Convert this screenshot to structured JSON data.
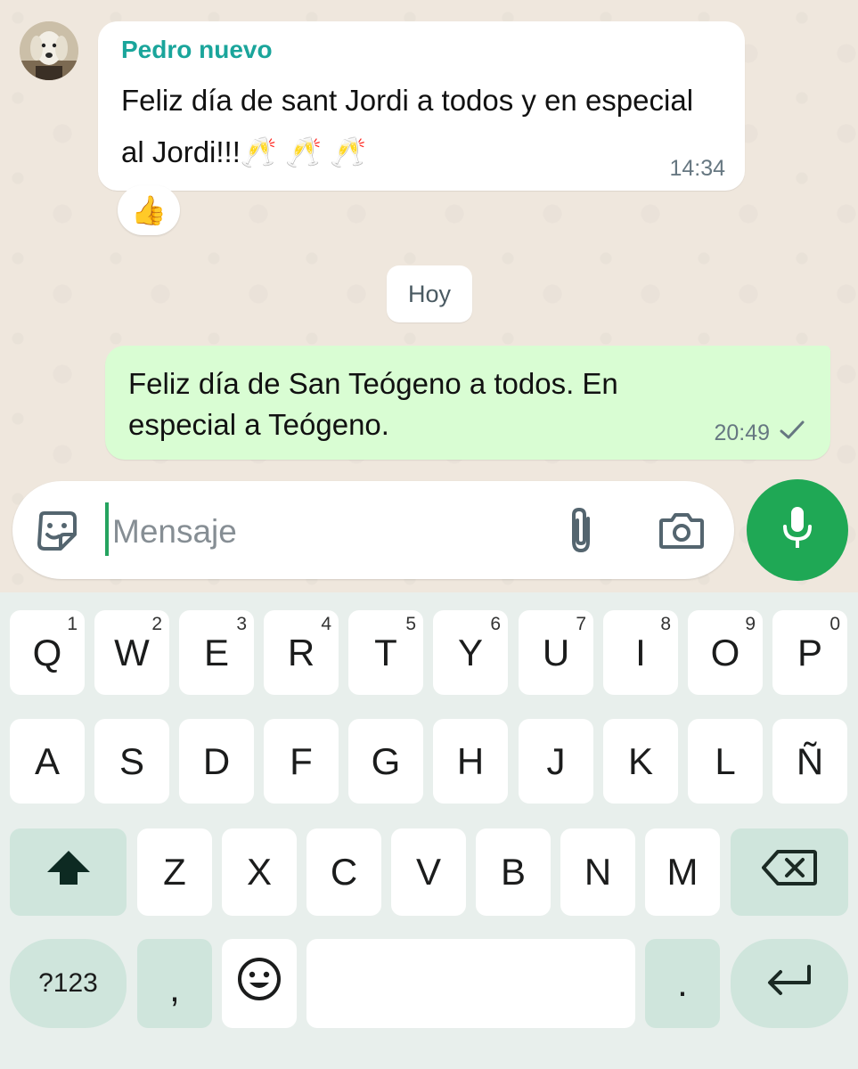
{
  "chat": {
    "incoming": {
      "sender": "Pedro nuevo",
      "text": "Feliz día de sant Jordi a todos y en especial al Jordi!!!🥂 🥂 🥂",
      "time": "14:34",
      "reaction": "👍"
    },
    "day_separator": "Hoy",
    "outgoing": {
      "text": "Feliz día de San Teógeno a todos. En especial a Teógeno.",
      "time": "20:49",
      "status_icon": "single-check-icon"
    }
  },
  "composer": {
    "placeholder": "Mensaje",
    "value": "",
    "icons": [
      "sticker-icon",
      "attach-icon",
      "camera-icon",
      "mic-icon"
    ]
  },
  "keyboard": {
    "row1": [
      {
        "label": "Q",
        "hint": "1"
      },
      {
        "label": "W",
        "hint": "2"
      },
      {
        "label": "E",
        "hint": "3"
      },
      {
        "label": "R",
        "hint": "4"
      },
      {
        "label": "T",
        "hint": "5"
      },
      {
        "label": "Y",
        "hint": "6"
      },
      {
        "label": "U",
        "hint": "7"
      },
      {
        "label": "I",
        "hint": "8"
      },
      {
        "label": "O",
        "hint": "9"
      },
      {
        "label": "P",
        "hint": "0"
      }
    ],
    "row2": [
      "A",
      "S",
      "D",
      "F",
      "G",
      "H",
      "J",
      "K",
      "L",
      "Ñ"
    ],
    "row3": [
      "Z",
      "X",
      "C",
      "V",
      "B",
      "N",
      "M"
    ],
    "row4": {
      "symbols": "?123",
      "comma": ",",
      "period": "."
    },
    "icons": [
      "shift-icon",
      "backspace-icon",
      "emoji-icon",
      "enter-icon"
    ]
  },
  "colors": {
    "accent_green": "#1fa855",
    "sender_name": "#1aa59b",
    "outgoing_bubble": "#d9fdd3",
    "keyboard_bg": "#e8efec",
    "function_key": "#cfe5dc"
  }
}
